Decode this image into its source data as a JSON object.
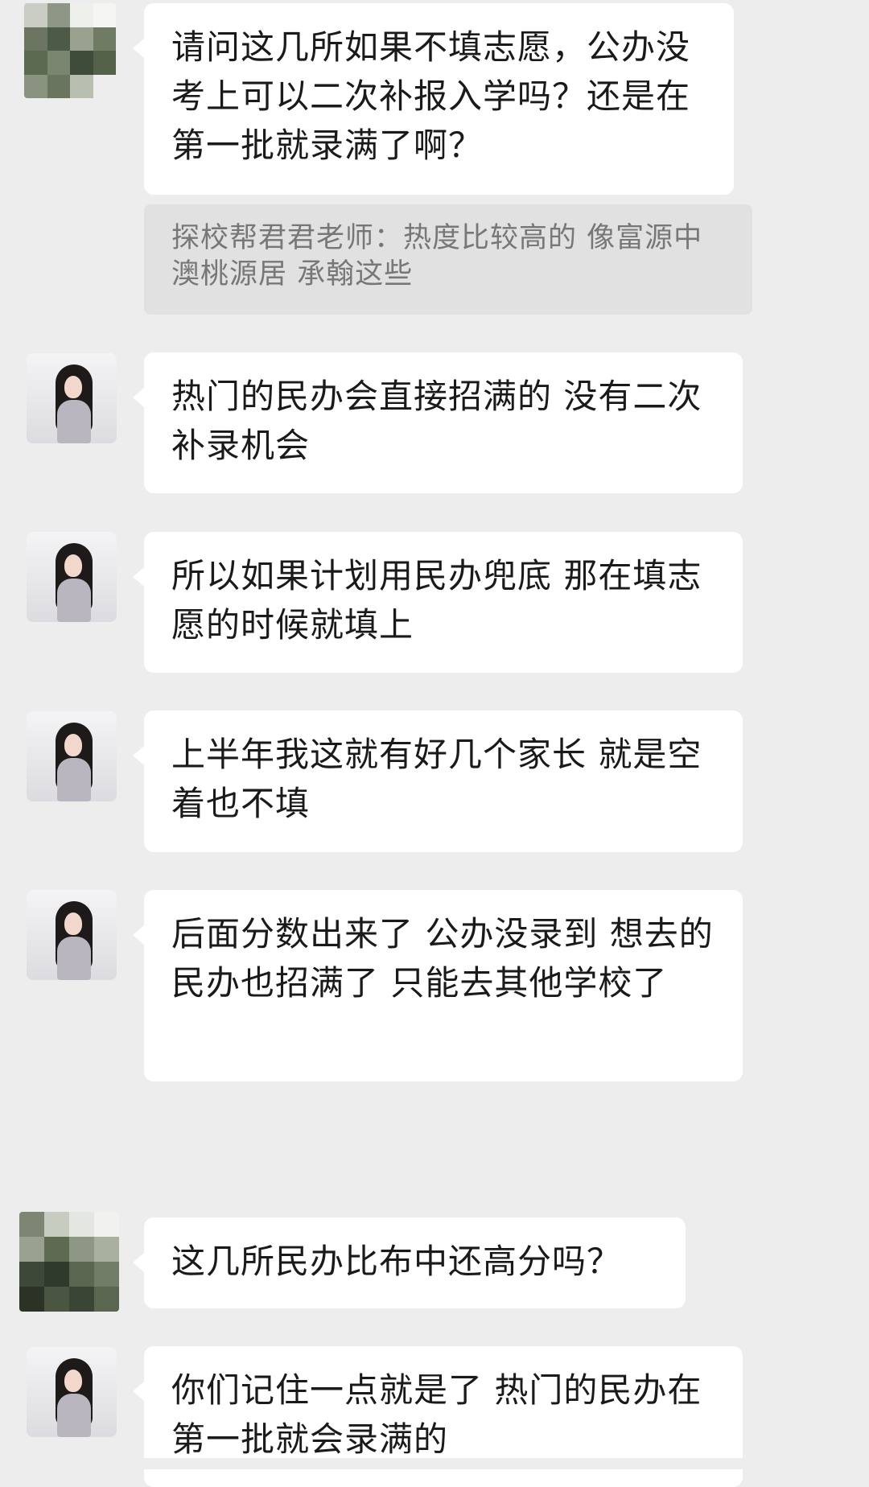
{
  "chat": {
    "messages": [
      {
        "sender": "parent",
        "text": "请问这几所如果不填志愿，公办没考上可以二次补报入学吗？还是在第一批就录满了啊？"
      },
      {
        "sender": "teacher",
        "text": "热门的民办会直接招满的 没有二次补录机会"
      },
      {
        "sender": "teacher",
        "text": "所以如果计划用民办兜底 那在填志愿的时候就填上"
      },
      {
        "sender": "teacher",
        "text": "上半年我这就有好几个家长 就是空着也不填"
      },
      {
        "sender": "teacher",
        "text": "后面分数出来了 公办没录到 想去的民办也招满了 只能去其他学校了"
      },
      {
        "sender": "parent",
        "text": "这几所民办比布中还高分吗？"
      },
      {
        "sender": "teacher",
        "text": "你们记住一点就是了 热门的民办在第一批就会录满的"
      }
    ],
    "quote": {
      "text": "探校帮君君老师：热度比较高的 像富源中澳桃源居 承翰这些"
    }
  },
  "colors": {
    "background": "#ededed",
    "bubble": "#ffffff",
    "quote_background": "#e1e1e1",
    "quote_text": "#777777",
    "text": "#1a1a1a"
  },
  "icons": {
    "parent_avatar": "pixelated-avatar",
    "teacher_avatar": "portrait-avatar"
  }
}
